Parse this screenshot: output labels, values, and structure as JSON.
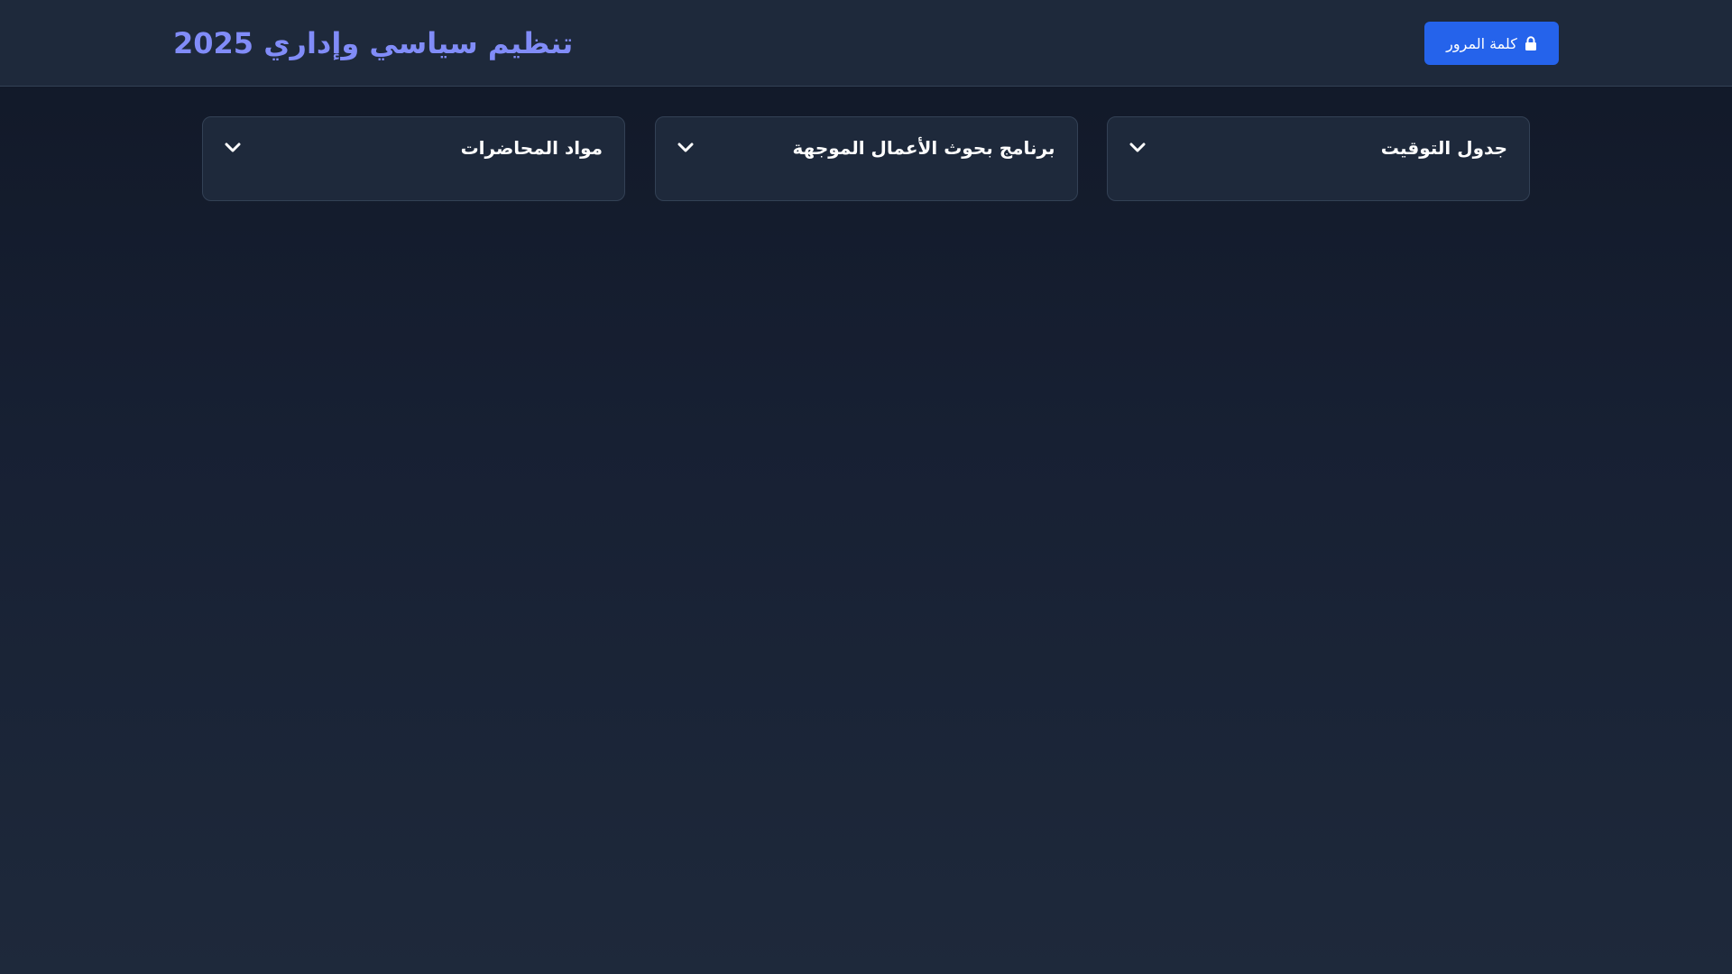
{
  "header": {
    "title": "تنظيم سياسي وإداري 2025",
    "password_button": {
      "label": "كلمة المرور",
      "icon": "lock-icon"
    }
  },
  "sections": [
    {
      "title": "جدول التوقيت",
      "icon": "chevron-down-icon"
    },
    {
      "title": "برنامج بحوث الأعمال الموجهة",
      "icon": "chevron-down-icon"
    },
    {
      "title": "مواد المحاضرات",
      "icon": "chevron-down-icon"
    }
  ],
  "colors": {
    "accent": "#818cf8",
    "button": "#2563eb",
    "card_bg": "#1e293b",
    "page_bg": "#111827"
  }
}
